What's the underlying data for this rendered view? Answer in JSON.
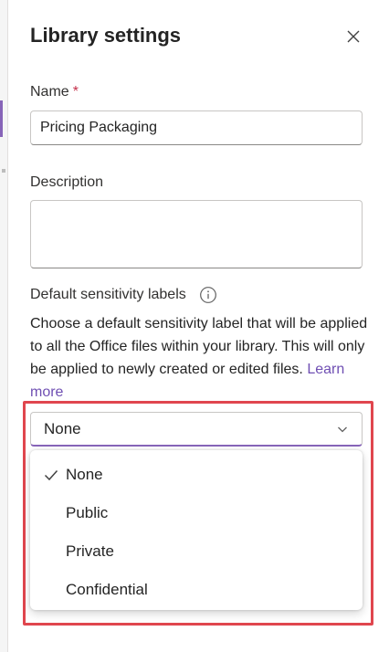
{
  "panel": {
    "title": "Library settings",
    "close_icon": "close-icon"
  },
  "name_field": {
    "label": "Name",
    "required_marker": "*",
    "value": "Pricing Packaging"
  },
  "description_field": {
    "label": "Description",
    "value": ""
  },
  "sensitivity": {
    "label": "Default sensitivity labels",
    "info_icon": "info-icon",
    "help_text": "Choose a default sensitivity label that will be applied to all the Office files within your library. This will only be applied to newly created or edited files.",
    "learn_more": "Learn more",
    "selected": "None",
    "options": [
      {
        "label": "None",
        "checked": true
      },
      {
        "label": "Public",
        "checked": false
      },
      {
        "label": "Private",
        "checked": false
      },
      {
        "label": "Confidential",
        "checked": false
      }
    ]
  },
  "colors": {
    "accent": "#8764b8",
    "link": "#6f4fb3",
    "required": "#c4314b",
    "highlight": "#e0464e"
  }
}
